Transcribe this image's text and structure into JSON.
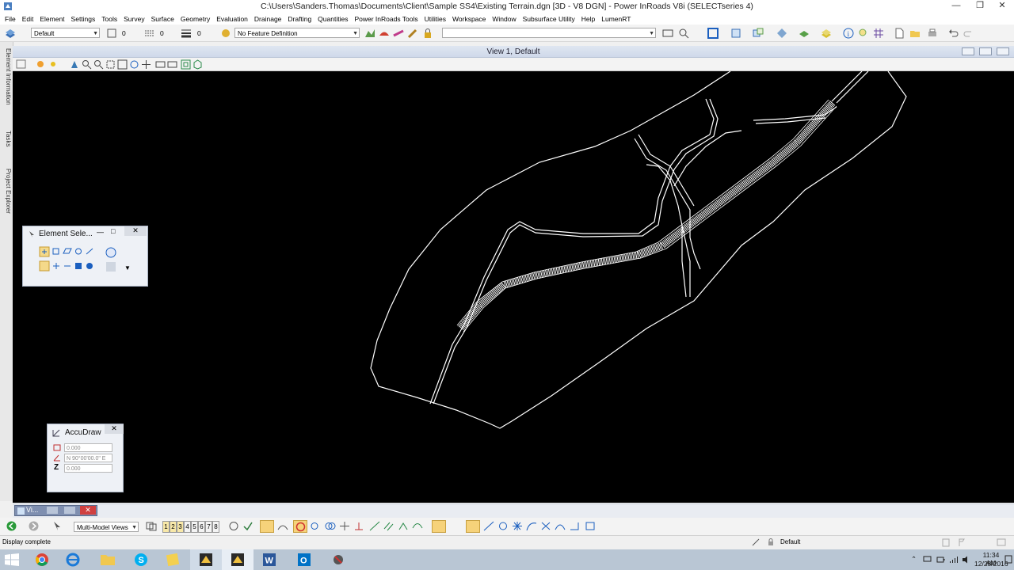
{
  "window": {
    "title": "C:\\Users\\Sanders.Thomas\\Documents\\Client\\Sample SS4\\Existing Terrain.dgn [3D - V8 DGN] - Power InRoads V8i (SELECTseries 4)",
    "minimize": "—",
    "maximize": "❐",
    "close": "✕"
  },
  "menu": [
    "File",
    "Edit",
    "Element",
    "Settings",
    "Tools",
    "Survey",
    "Surface",
    "Geometry",
    "Evaluation",
    "Drainage",
    "Drafting",
    "Quantities",
    "Power InRoads Tools",
    "Utilities",
    "Workspace",
    "Window",
    "Help",
    "Subsurface Utility",
    "Help",
    "LumenRT"
  ],
  "toolbar": {
    "level": "Default",
    "color_value": "0",
    "style_value": "0",
    "weight_value": "0",
    "feature_definition": "No Feature Definition",
    "command_box": ""
  },
  "left_dock": {
    "tab_element_info": "Element Information",
    "tab_tasks": "Tasks",
    "tab_project_explorer": "Project Explorer"
  },
  "view": {
    "title": "View 1, Default"
  },
  "element_selection": {
    "title": "Element Sele..."
  },
  "accudraw": {
    "title": "AccuDraw",
    "distance": "0.000",
    "angle": "N 90°00'00.0\" E",
    "z_label": "Z",
    "z": "0.000"
  },
  "view_tab": {
    "label": "Vi..."
  },
  "bottom_toolbar": {
    "multi_model": "Multi-Model Views",
    "view_numbers": [
      "1",
      "2",
      "3",
      "4",
      "5",
      "6",
      "7",
      "8"
    ]
  },
  "status": {
    "message": "Display complete",
    "active_level": "Default"
  },
  "taskbar": {
    "time": "11:34 AM",
    "date": "12/28/2016"
  },
  "colors": {
    "canvas": "#000000",
    "linework": "#ffffff",
    "taskbar": "#b9c6d4"
  }
}
